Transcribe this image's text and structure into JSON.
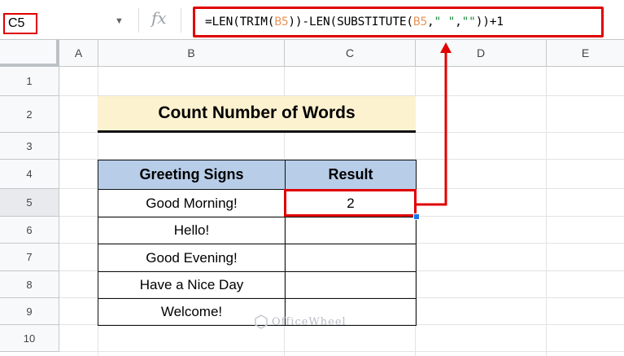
{
  "formula_bar": {
    "name_box": "C5",
    "fx_label": "fx",
    "formula_parts": [
      "=LEN(TRIM(",
      "B5",
      "))-LEN(SUBSTITUTE(",
      "B5",
      ",",
      "\" \"",
      ",",
      "\"\"",
      "))+1"
    ]
  },
  "columns": [
    "A",
    "B",
    "C",
    "D",
    "E"
  ],
  "rows": [
    "1",
    "2",
    "3",
    "4",
    "5",
    "6",
    "7",
    "8",
    "9",
    "10"
  ],
  "sheet": {
    "title": "Count Number of Words",
    "table_headers": [
      "Greeting Signs",
      "Result"
    ],
    "table_rows": [
      {
        "greeting": "Good Morning!",
        "result": "2"
      },
      {
        "greeting": "Hello!",
        "result": ""
      },
      {
        "greeting": "Good Evening!",
        "result": ""
      },
      {
        "greeting": "Have a Nice Day",
        "result": ""
      },
      {
        "greeting": "Welcome!",
        "result": ""
      }
    ]
  },
  "watermark": "OfficeWheel",
  "colors": {
    "highlight_red": "#e00000",
    "title_fill": "#fdf2d0",
    "header_fill": "#b7cde8",
    "selection_blue": "#1a73e8"
  }
}
